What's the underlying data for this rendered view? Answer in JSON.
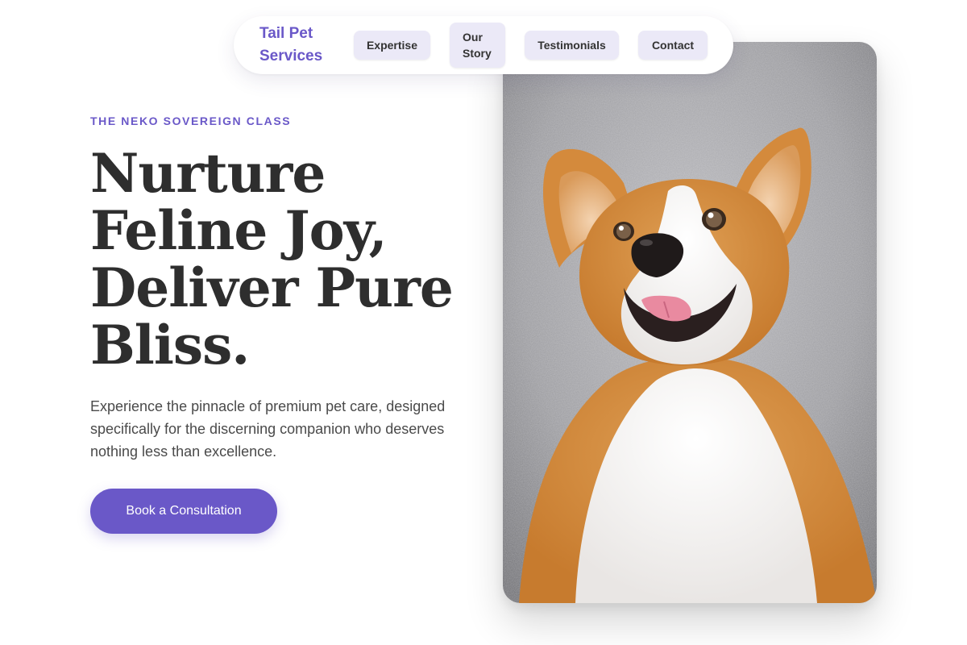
{
  "brand": {
    "name": "Tail Pet Services"
  },
  "nav": {
    "items": [
      {
        "label": "Expertise"
      },
      {
        "label": "Our Story"
      },
      {
        "label": "Testimonials"
      },
      {
        "label": "Contact"
      }
    ]
  },
  "hero": {
    "eyebrow": "THE NEKO SOVEREIGN CLASS",
    "headline": "Nurture Feline Joy, Deliver Pure Bliss.",
    "subtext": "Experience the pinnacle of premium pet care, designed specifically for the discerning companion who deserves nothing less than excellence.",
    "cta_label": "Book a Consultation"
  },
  "colors": {
    "accent": "#6a58c8",
    "nav_button_bg": "#ebe9f7",
    "headline": "#2e2e2e"
  }
}
